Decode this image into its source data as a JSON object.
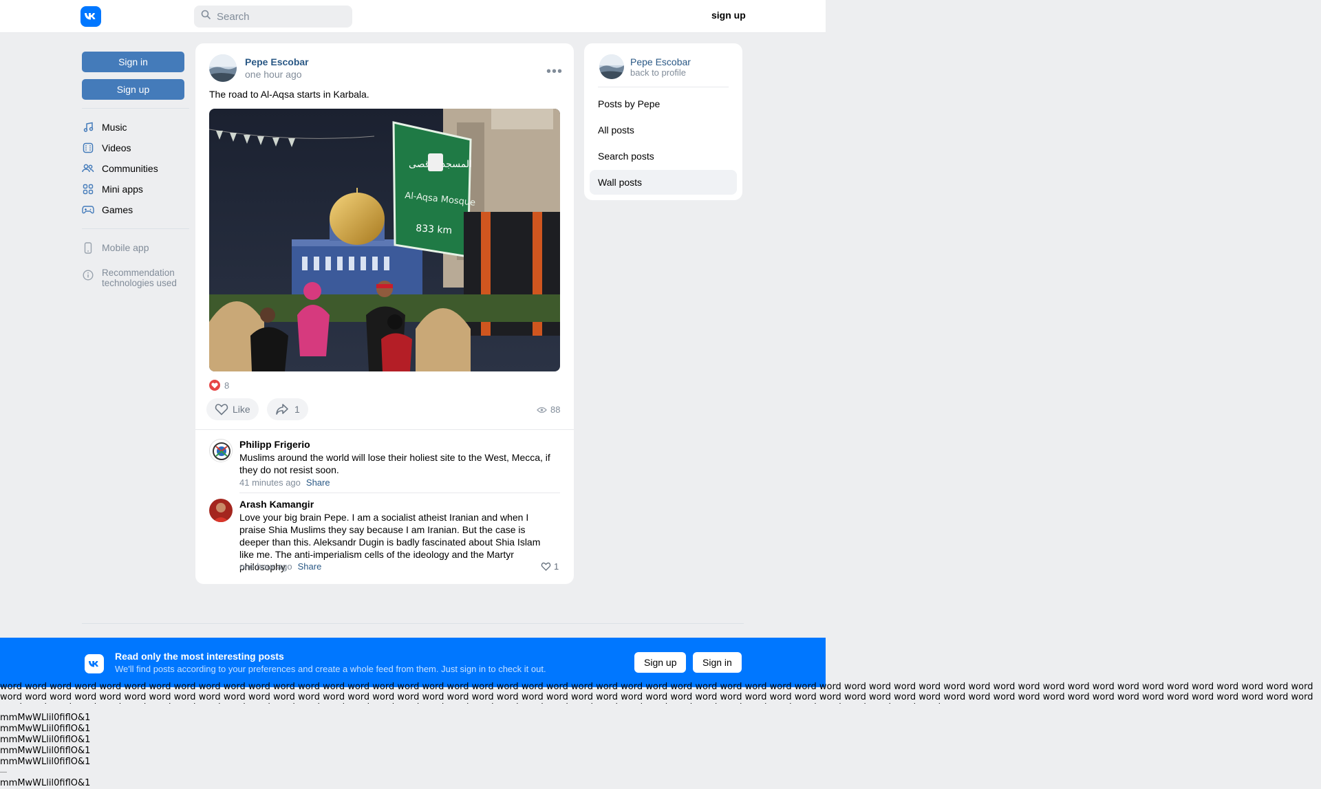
{
  "header": {
    "search_placeholder": "Search",
    "signup_label": "sign up"
  },
  "sidebar": {
    "signin_label": "Sign in",
    "signup_label": "Sign up",
    "nav": [
      {
        "label": "Music",
        "icon": "music-icon"
      },
      {
        "label": "Videos",
        "icon": "videos-icon"
      },
      {
        "label": "Communities",
        "icon": "communities-icon"
      },
      {
        "label": "Mini apps",
        "icon": "mini-apps-icon"
      },
      {
        "label": "Games",
        "icon": "games-icon"
      }
    ],
    "mobile_app": "Mobile app",
    "recommendation_line1": "Recommendation",
    "recommendation_line2": "technologies used"
  },
  "post": {
    "author": "Pepe Escobar",
    "time": "one hour ago",
    "text": "The road to Al-Aqsa starts in Karbala.",
    "image": {
      "sign_arabic": "المسجد الأقصى",
      "sign_text": "Al-Aqsa Mosque",
      "sign_distance": "833 km"
    },
    "reactions_count": "8",
    "like_label": "Like",
    "share_count": "1",
    "views": "88"
  },
  "comments": [
    {
      "author": "Philipp Frigerio",
      "text": "Muslims around the world will lose their holiest site to the West, Mecca, if they do not resist soon.",
      "time": "41 minutes ago",
      "share_label": "Share"
    },
    {
      "author": "Arash Kamangir",
      "text": "Love your big brain Pepe. I am a socialist atheist Iranian and when I praise Shia Muslims they say because I am Iranian. But the case is deeper than this. Aleksandr Dugin is badly fascinated about Shia Islam like me. The anti-imperialism cells of the ideology and the Martyr philosophy.",
      "time": "one hour ago",
      "share_label": "Share",
      "likes": "1"
    }
  ],
  "right_panel": {
    "name": "Pepe Escobar",
    "back": "back to profile",
    "items": [
      "Posts by Pepe",
      "All posts",
      "Search posts",
      "Wall posts"
    ],
    "active_item": "Wall posts"
  },
  "banner": {
    "title": "Read only the most interesting posts",
    "subtitle": "We'll find posts according to your preferences and create a whole feed from them. Just sign in to check it out.",
    "signup_label": "Sign up",
    "signin_label": "Sign in"
  },
  "filler": {
    "word_text": "word word word word word word word word word word word word word word word word word word word word word word word word word word word word word word word word word word word word word word word word word word word word word word word word word word word word word word word word word word word word word word word word word word word word word word word word word word word word word word word word word word word word word word word word word word word word word word word word word word word word word word word word word word word word word word word word word word word word word word word word word word word word word word word word word word word word word word word word word word word word word word word word",
    "glyph_line": "mmMwWLlil0fiflO&1"
  },
  "colors": {
    "brand": "#0077ff",
    "button_blue": "#447bba",
    "link": "#2a5885",
    "background": "#edeef0"
  }
}
